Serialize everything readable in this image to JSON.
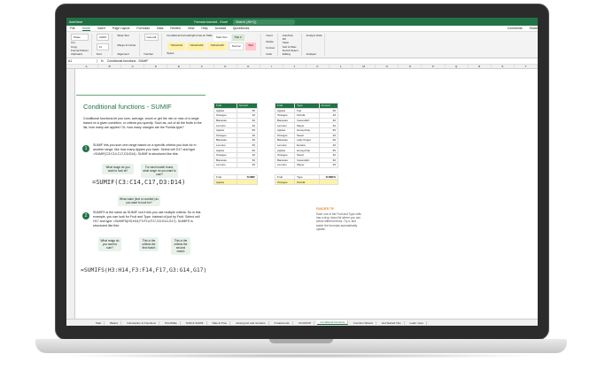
{
  "app": {
    "title": "Formula tutorial1 - Excel",
    "search_placeholder": "Search (Alt+Q)",
    "autosave": "AutoSave"
  },
  "menus": [
    "File",
    "Home",
    "Insert",
    "Page Layout",
    "Formulas",
    "Data",
    "Review",
    "View",
    "Help",
    "Acrobat",
    "QuickBooks"
  ],
  "menus_right": [
    "Comments",
    "Share"
  ],
  "ribbon": {
    "paste": "Paste",
    "cut": "Cut",
    "copy": "Copy",
    "fmt": "Format Painter",
    "clipboard": "Clipboard",
    "font": "Calibri",
    "size": "11",
    "fontgrp": "Font",
    "wrap": "Wrap Text",
    "merge": "Merge & Center",
    "align": "Alignment",
    "numfmt": "General",
    "number": "Number",
    "cond": "Conditional Formatting",
    "fmtTable": "Format as Table",
    "styles": [
      "Start Text",
      "Title 2",
      "YellowCell",
      "YellowCell2",
      "YellowCell3",
      "Normal",
      "Bad"
    ],
    "stylesgrp": "Styles",
    "cells": [
      "Insert",
      "Delete",
      "Format"
    ],
    "cellsgrp": "Cells",
    "editing": [
      "AutoSum",
      "Fill",
      "Clear",
      "Sort & Filter",
      "Find & Select"
    ],
    "editgrp": "Editing",
    "analyze": "Analyze Data",
    "analysis": "Analysis"
  },
  "formula": {
    "name": "A1",
    "fx": "fx",
    "content": "Conditional functions - SUMIF"
  },
  "cols": [
    "A",
    "B",
    "C",
    "D",
    "E",
    "F",
    "G",
    "H",
    "I",
    "J",
    "K",
    "L",
    "M",
    "N",
    "O",
    "P",
    "Q",
    "R",
    "S",
    "T"
  ],
  "panel": {
    "title": "Conditional functions - SUMIF",
    "intro": "Conditional functions let you sum, average, count or get the min or max of a range based on a given condition, or criteria you specify. Such as, out of all the fruits in the list, how many are apples? Or, how many oranges are the Florida type?",
    "step1": "1",
    "s1text": "SUMIF lets you sum one range based on a specific criteria you look for in another range, like how many Apples you have. Select cell D17 and type =SUMIF(C3:C14,C17,D3:D14). SUMIF is structured like this:",
    "b1": "What range do you want to look at?",
    "b2": "For each match found, what range do you want to sum?",
    "f1": "=SUMIF(C3:C14,C17,D3:D14)",
    "b3": "What value (text or number) do you want to look for?",
    "step2": "2",
    "s2text": "SUMIFS is the same as SUMIF, but it lets you use multiple criteria. So in this example, you can look for Fruit and Type, instead of just by Fruit. Select cell H17 and type =SUMIFS(H3:H14,F3:F14,F17,G3:G14,G17). SUMIFS is structured like this:",
    "b4": "What range do you want to sum?",
    "b5": "This is the criteria the first match",
    "b6": "This is the criteria the second match",
    "f2": "=SUMIFS(H3:H14,F3:F14,F17,G3:G14,G17)"
  },
  "table1": {
    "headers": [
      "Fruit",
      "Amount"
    ],
    "rows": [
      [
        "Apples",
        "50"
      ],
      [
        "Oranges",
        "20"
      ],
      [
        "Bananas",
        "60"
      ],
      [
        "Lemons",
        "40"
      ],
      [
        "Apples",
        "50"
      ],
      [
        "Oranges",
        "20"
      ],
      [
        "Bananas",
        "60"
      ],
      [
        "Lemons",
        "40"
      ],
      [
        "Apples",
        "50"
      ],
      [
        "Oranges",
        "20"
      ],
      [
        "Bananas",
        "60"
      ],
      [
        "Lemons",
        "40"
      ]
    ],
    "in_headers": [
      "Fruit",
      "SUMIF"
    ],
    "in_row": [
      "Apples",
      ""
    ]
  },
  "table2": {
    "headers": [
      "Fruit",
      "Type",
      "Amount"
    ],
    "rows": [
      [
        "Apples",
        "Fuji",
        "50"
      ],
      [
        "Oranges",
        "Florida",
        "20"
      ],
      [
        "Bananas",
        "Cavendish",
        "60"
      ],
      [
        "Lemons",
        "Meyer",
        "40"
      ],
      [
        "Apples",
        "Honeycrisp",
        "50"
      ],
      [
        "Oranges",
        "Navel",
        "20"
      ],
      [
        "Bananas",
        "Lady Finger",
        "60"
      ],
      [
        "Lemons",
        "Eureka",
        "40"
      ],
      [
        "Apples",
        "Honeycrisp",
        "50"
      ],
      [
        "Oranges",
        "Navel",
        "20"
      ],
      [
        "Bananas",
        "Cavendish",
        "60"
      ],
      [
        "Lemons",
        "Meyer",
        "40"
      ]
    ],
    "in_headers": [
      "Fruit",
      "Type",
      "SUMIFS"
    ],
    "in_row": [
      "Oranges",
      "Florida",
      ""
    ]
  },
  "tip": {
    "title": "FANCIER TIP",
    "text": "Each one of the Fruit and Type cells has a drop down list where you can select different items. Try it, and watch the formulas automatically update."
  },
  "tabs": [
    "Start",
    "Basics",
    "Introduction to Functions",
    "PivotTable",
    "SUM & SUMIF",
    "Date & Time",
    "Joining text and numbers",
    "If statements",
    "VLOOKUP",
    "Conditional functions",
    "Function Wizard",
    "Get Started Tips",
    "Learn more"
  ],
  "active_tab": "Conditional functions",
  "colors": {
    "accent": "#217346",
    "yellow": "#fff2a8"
  }
}
